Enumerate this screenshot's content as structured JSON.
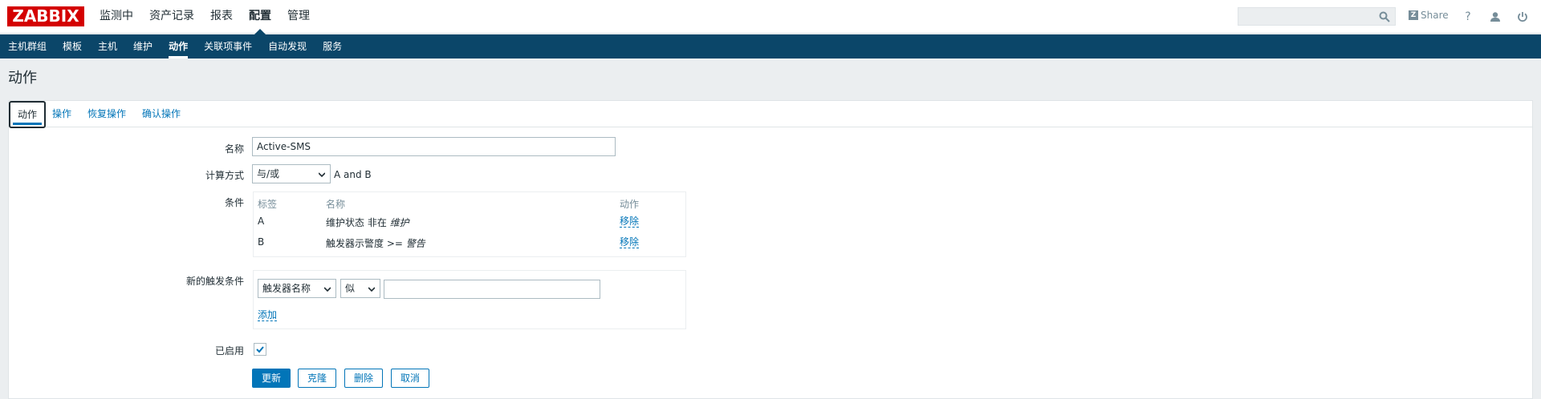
{
  "header": {
    "logo": "ZABBIX",
    "menu": [
      {
        "label": "监测中",
        "selected": false
      },
      {
        "label": "资产记录",
        "selected": false
      },
      {
        "label": "报表",
        "selected": false
      },
      {
        "label": "配置",
        "selected": true
      },
      {
        "label": "管理",
        "selected": false
      }
    ],
    "search_placeholder": "",
    "share_label": "Share",
    "help_icon": "?"
  },
  "submenu": [
    {
      "label": "主机群组",
      "selected": false
    },
    {
      "label": "模板",
      "selected": false
    },
    {
      "label": "主机",
      "selected": false
    },
    {
      "label": "维护",
      "selected": false
    },
    {
      "label": "动作",
      "selected": true
    },
    {
      "label": "关联项事件",
      "selected": false
    },
    {
      "label": "自动发现",
      "selected": false
    },
    {
      "label": "服务",
      "selected": false
    }
  ],
  "page_title": "动作",
  "tabs": [
    {
      "label": "动作",
      "active": true
    },
    {
      "label": "操作",
      "active": false
    },
    {
      "label": "恢复操作",
      "active": false
    },
    {
      "label": "确认操作",
      "active": false
    }
  ],
  "form": {
    "name_label": "名称",
    "name_value": "Active-SMS",
    "calc_label": "计算方式",
    "calc_value": "与/或",
    "calc_expression": "A and B",
    "conditions_label": "条件",
    "conditions_headers": {
      "tag": "标签",
      "name": "名称",
      "action": "动作"
    },
    "conditions": [
      {
        "tag": "A",
        "name_prefix": "维护状态 非在 ",
        "name_value": "维护",
        "action": "移除"
      },
      {
        "tag": "B",
        "name_prefix": "触发器示警度 >= ",
        "name_value": "警告",
        "action": "移除"
      }
    ],
    "new_condition_label": "新的触发条件",
    "new_condition_type": "触发器名称",
    "new_condition_operator": "似",
    "new_condition_value": "",
    "add_label": "添加",
    "enabled_label": "已启用",
    "enabled": true
  },
  "buttons": {
    "update": "更新",
    "clone": "克隆",
    "delete": "删除",
    "cancel": "取消"
  },
  "colors": {
    "brand_red": "#d40000",
    "nav_blue": "#0b4669",
    "link_blue": "#0275b8"
  }
}
